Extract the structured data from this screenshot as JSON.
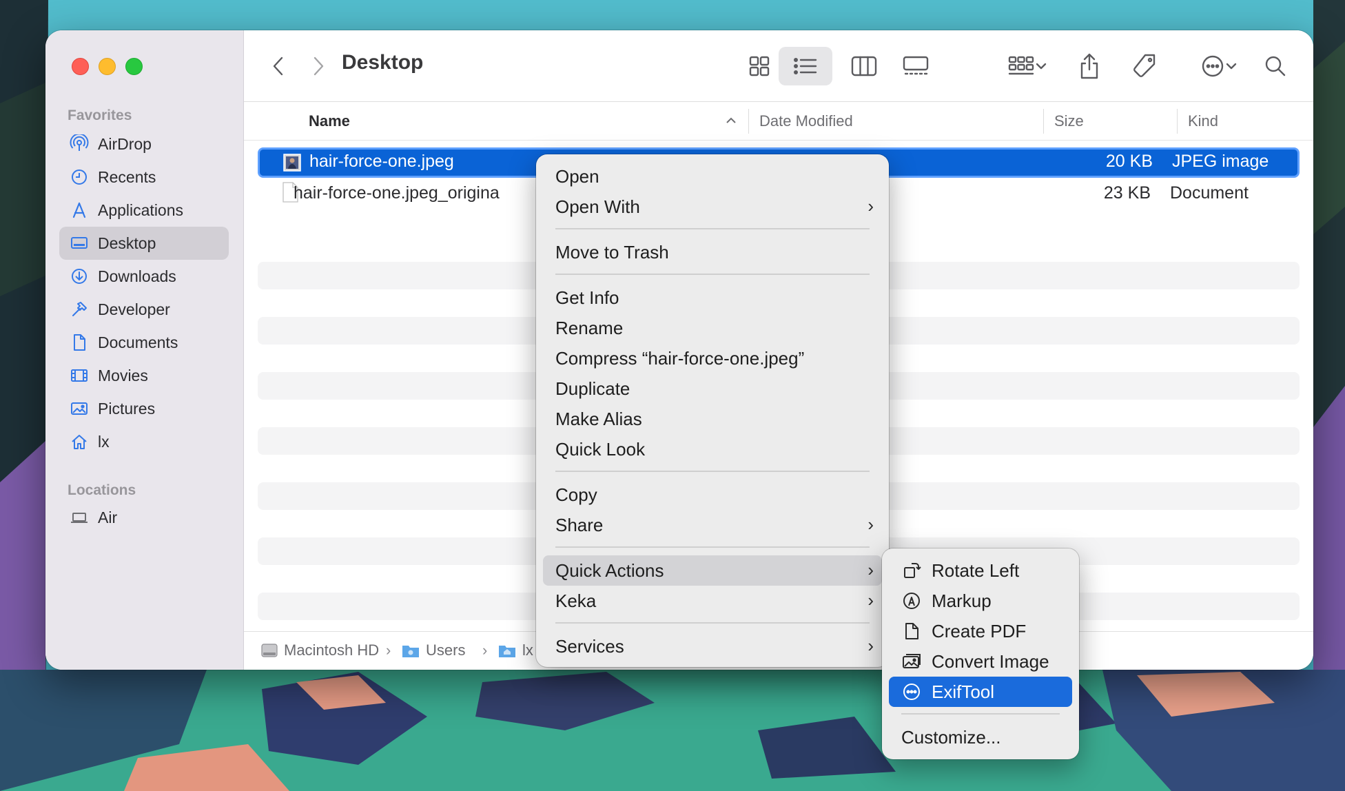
{
  "window": {
    "title": "Desktop"
  },
  "sidebar": {
    "favorites_label": "Favorites",
    "locations_label": "Locations",
    "favorites": [
      {
        "label": "AirDrop",
        "icon": "airdrop-icon"
      },
      {
        "label": "Recents",
        "icon": "clock-icon"
      },
      {
        "label": "Applications",
        "icon": "applications-icon"
      },
      {
        "label": "Desktop",
        "icon": "desktop-icon",
        "selected": true
      },
      {
        "label": "Downloads",
        "icon": "download-icon"
      },
      {
        "label": "Developer",
        "icon": "hammer-icon"
      },
      {
        "label": "Documents",
        "icon": "document-icon"
      },
      {
        "label": "Movies",
        "icon": "film-icon"
      },
      {
        "label": "Pictures",
        "icon": "photo-icon"
      },
      {
        "label": "lx",
        "icon": "home-icon"
      }
    ],
    "locations": [
      {
        "label": "Air",
        "icon": "laptop-icon"
      }
    ]
  },
  "columns": {
    "name": "Name",
    "date_modified": "Date Modified",
    "size": "Size",
    "kind": "Kind"
  },
  "files": [
    {
      "name": "hair-force-one.jpeg",
      "size": "20 KB",
      "kind": "JPEG image",
      "selected": true
    },
    {
      "name": "hair-force-one.jpeg_origina",
      "size": "23 KB",
      "kind": "Document",
      "selected": false
    }
  ],
  "pathbar": {
    "items": [
      "Macintosh HD",
      "Users",
      "lx"
    ],
    "separator": "›"
  },
  "context_menu": {
    "group1": [
      "Open",
      "Open With"
    ],
    "group2": [
      "Move to Trash"
    ],
    "group3": [
      "Get Info",
      "Rename",
      "Compress “hair-force-one.jpeg”",
      "Duplicate",
      "Make Alias",
      "Quick Look"
    ],
    "group4": [
      "Copy",
      "Share"
    ],
    "group5": [
      "Quick Actions",
      "Keka"
    ],
    "group6": [
      "Services"
    ],
    "submenu_chevron": "›"
  },
  "quick_actions_menu": {
    "items": [
      {
        "label": "Rotate Left",
        "icon": "rotate-left-icon"
      },
      {
        "label": "Markup",
        "icon": "markup-icon"
      },
      {
        "label": "Create PDF",
        "icon": "pdf-icon"
      },
      {
        "label": "Convert Image",
        "icon": "convert-image-icon"
      },
      {
        "label": "ExifTool",
        "icon": "ellipsis-circle-icon",
        "highlighted": true
      }
    ],
    "customize": "Customize..."
  },
  "colors": {
    "selection_blue": "#0a63d6",
    "menu_highlight": "#1a6bdc",
    "sidebar_bg": "#e9e6ec"
  }
}
